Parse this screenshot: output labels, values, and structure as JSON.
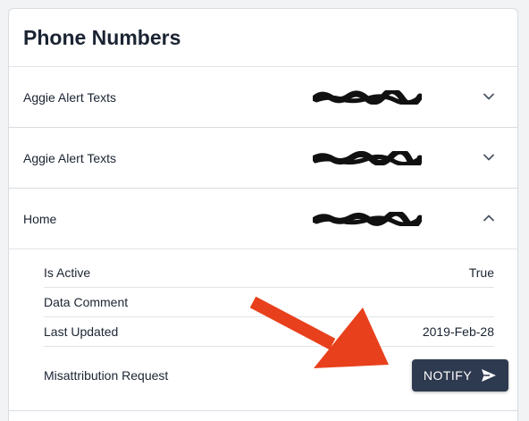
{
  "card": {
    "title": "Phone Numbers"
  },
  "phones": [
    {
      "label": "Aggie Alert Texts",
      "value_redacted": true,
      "expanded": false,
      "chevron": "chevron-down-icon"
    },
    {
      "label": "Aggie Alert Texts",
      "value_redacted": true,
      "expanded": false,
      "chevron": "chevron-down-icon"
    },
    {
      "label": "Home",
      "value_redacted": true,
      "expanded": true,
      "chevron": "chevron-up-icon"
    }
  ],
  "details": {
    "is_active_label": "Is Active",
    "is_active_value": "True",
    "data_comment_label": "Data Comment",
    "data_comment_value": "",
    "last_updated_label": "Last Updated",
    "last_updated_value": "2019-Feb-28",
    "misattribution_label": "Misattribution Request",
    "notify_label": "NOTIFY"
  },
  "colors": {
    "button_bg": "#2e3a4f",
    "annotation_arrow": "#e8401c",
    "title_text": "#1b2432"
  }
}
